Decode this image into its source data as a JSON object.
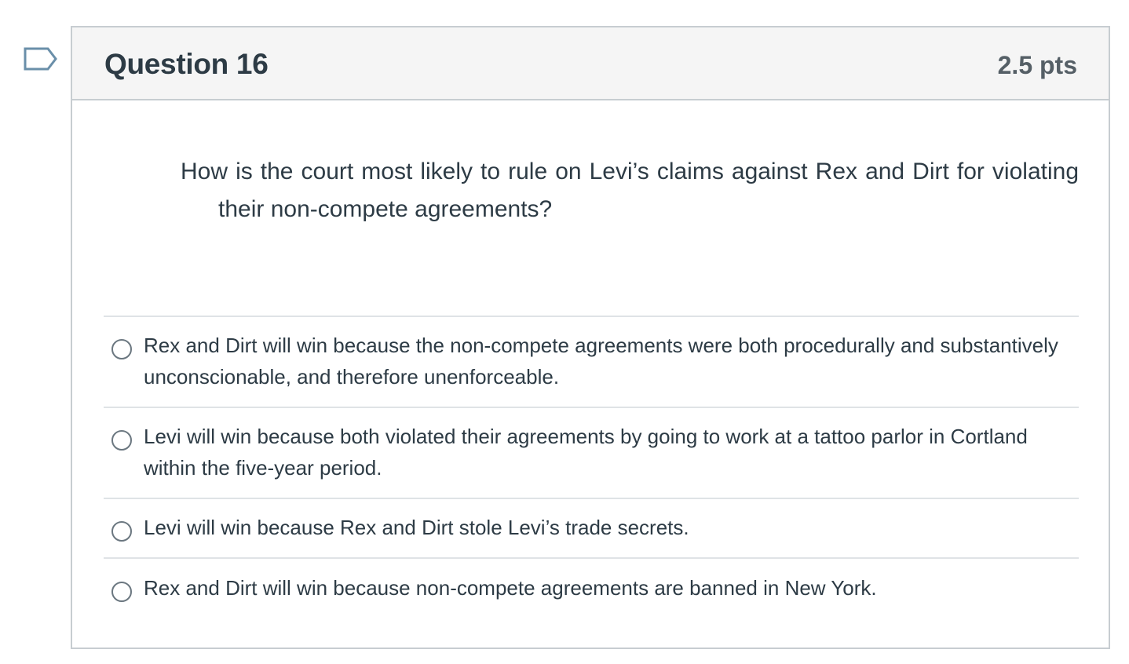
{
  "question": {
    "title": "Question 16",
    "points": "2.5 pts",
    "text": "How is the court most likely to rule on Levi’s claims against Rex and Dirt for violating their non-compete agreements?",
    "flag_icon": "flag-bookmark-icon"
  },
  "answers": [
    {
      "label": "Rex and Dirt will win because the non-compete agreements were both procedurally and substantively unconscionable, and therefore unenforceable.",
      "selected": false
    },
    {
      "label": "Levi will win because both violated their agreements by going to work at a tattoo parlor in Cortland within the five-year period.",
      "selected": false
    },
    {
      "label": "Levi will win because Rex and Dirt stole Levi’s trade secrets.",
      "selected": false
    },
    {
      "label": "Rex and Dirt will win because non-compete agreements are banned in New York.",
      "selected": false
    }
  ],
  "colors": {
    "header_bg": "#f5f5f5",
    "border": "#c7cdd1",
    "text": "#2d3b45",
    "points_text": "#555f66",
    "flag_stroke": "#6a8fa9"
  }
}
